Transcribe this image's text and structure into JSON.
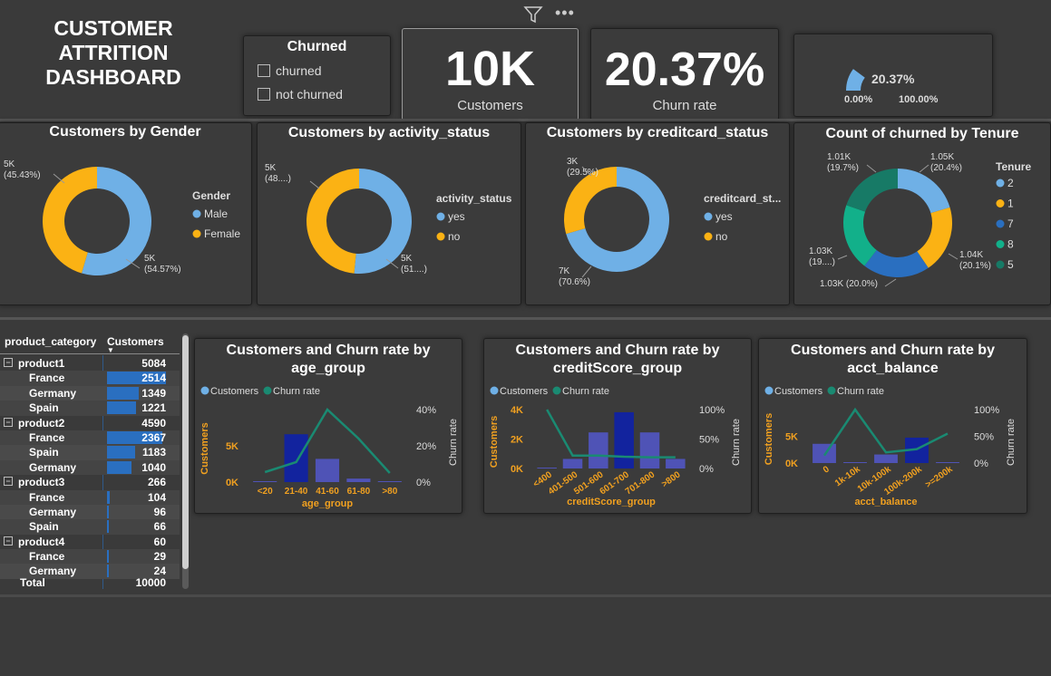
{
  "title": "CUSTOMER ATTRITION DASHBOARD",
  "title_lines": [
    "CUSTOMER",
    "ATTRITION",
    "DASHBOARD"
  ],
  "toolbar": {
    "filter_icon": "filter-icon",
    "more_icon": "more-options-icon"
  },
  "slicer": {
    "title": "Churned",
    "options": [
      "churned",
      "not churned"
    ]
  },
  "kpis": {
    "customers_value": "10K",
    "customers_label": "Customers",
    "churn_value": "20.37%",
    "churn_label": "Churn rate"
  },
  "gauge": {
    "value": 0.2037,
    "value_label": "20.37%",
    "min_label": "0.00%",
    "max_label": "100.00%"
  },
  "colors": {
    "blue": "#6fb0e6",
    "orange": "#fbb214",
    "navy": "#12239e",
    "purple": "#4f53b6",
    "teal": "#1a8a72",
    "green": "#12b08a",
    "darkblue": "#2a6fc0",
    "darkteal": "#177a66"
  },
  "donuts": [
    {
      "title": "Customers by Gender",
      "legend_title": "Gender",
      "legend": [
        "Male",
        "Female"
      ],
      "values": [
        54.57,
        45.43
      ],
      "labels": [
        [
          "5K",
          "(54.57%)"
        ],
        [
          "5K",
          "(45.43%)"
        ]
      ]
    },
    {
      "title": "Customers by activity_status",
      "legend_title": "activity_status",
      "legend": [
        "yes",
        "no"
      ],
      "values": [
        51.5,
        48.5
      ],
      "labels": [
        [
          "5K",
          "(51....)"
        ],
        [
          "5K",
          "(48....)"
        ]
      ]
    },
    {
      "title": "Customers by creditcard_status",
      "legend_title": "creditcard_st...",
      "legend": [
        "yes",
        "no"
      ],
      "values": [
        70.6,
        29.5
      ],
      "labels": [
        [
          "7K",
          "(70.6%)"
        ],
        [
          "3K",
          "(29.5%)"
        ]
      ]
    },
    {
      "title": "Count of churned by Tenure",
      "legend_title": "Tenure",
      "legend": [
        "2",
        "1",
        "7",
        "8",
        "5"
      ],
      "values": [
        20.4,
        20.1,
        20.0,
        19.8,
        19.7
      ],
      "labels": [
        [
          "1.05K",
          "(20.4%)"
        ],
        [
          "1.04K",
          "(20.1%)"
        ],
        [
          "1.03K (20.0%)",
          ""
        ],
        [
          "1.03K",
          "(19....)"
        ],
        [
          "1.01K",
          "(19.7%)"
        ]
      ]
    }
  ],
  "table": {
    "headers": [
      "product_category",
      "Customers"
    ],
    "rows": [
      {
        "label": "product1",
        "value": "5084",
        "level": 0,
        "frac": 0
      },
      {
        "label": "France",
        "value": "2514",
        "level": 1,
        "frac": 1.0
      },
      {
        "label": "Germany",
        "value": "1349",
        "level": 1,
        "frac": 0.537
      },
      {
        "label": "Spain",
        "value": "1221",
        "level": 1,
        "frac": 0.486
      },
      {
        "label": "product2",
        "value": "4590",
        "level": 0,
        "frac": 0
      },
      {
        "label": "France",
        "value": "2367",
        "level": 1,
        "frac": 0.942
      },
      {
        "label": "Spain",
        "value": "1183",
        "level": 1,
        "frac": 0.471
      },
      {
        "label": "Germany",
        "value": "1040",
        "level": 1,
        "frac": 0.414
      },
      {
        "label": "product3",
        "value": "266",
        "level": 0,
        "frac": 0
      },
      {
        "label": "France",
        "value": "104",
        "level": 1,
        "frac": 0.041
      },
      {
        "label": "Germany",
        "value": "96",
        "level": 1,
        "frac": 0.038
      },
      {
        "label": "Spain",
        "value": "66",
        "level": 1,
        "frac": 0.026
      },
      {
        "label": "product4",
        "value": "60",
        "level": 0,
        "frac": 0
      },
      {
        "label": "France",
        "value": "29",
        "level": 1,
        "frac": 0.012
      },
      {
        "label": "Germany",
        "value": "24",
        "level": 1,
        "frac": 0.01
      }
    ],
    "total_label": "Total",
    "total_value": "10000"
  },
  "chart_data": [
    {
      "type": "bar",
      "title": "Customers and Churn rate by age_group",
      "legend": [
        "Customers",
        "Churn rate"
      ],
      "categories": [
        "<20",
        "21-40",
        "41-60",
        "61-80",
        ">80"
      ],
      "series": [
        {
          "name": "Customers",
          "values": [
            90,
            6600,
            3200,
            480,
            80
          ]
        },
        {
          "name": "Churn rate",
          "values": [
            5.5,
            11,
            40,
            24,
            5
          ]
        }
      ],
      "xlabel": "age_group",
      "ylabel": "Customers",
      "y2label": "Churn rate",
      "ylim": [
        0,
        10000
      ],
      "y2lim": [
        0,
        40
      ],
      "yticks": [
        "0K",
        "5K"
      ],
      "y2ticks": [
        "0%",
        "20%",
        "40%"
      ]
    },
    {
      "type": "bar",
      "title": "Customers and Churn rate by creditScore_group",
      "legend": [
        "Customers",
        "Churn rate"
      ],
      "categories": [
        "<400",
        "401-500",
        "501-600",
        "601-700",
        "701-800",
        ">800"
      ],
      "series": [
        {
          "name": "Customers",
          "values": [
            20,
            650,
            2450,
            3820,
            2450,
            650
          ]
        },
        {
          "name": "Churn rate",
          "values": [
            100,
            22,
            22,
            20,
            19,
            19
          ]
        }
      ],
      "xlabel": "creditScore_group",
      "ylabel": "Customers",
      "y2label": "Churn rate",
      "ylim": [
        0,
        4000
      ],
      "y2lim": [
        0,
        100
      ],
      "yticks": [
        "0K",
        "2K",
        "4K"
      ],
      "y2ticks": [
        "0%",
        "50%",
        "100%"
      ]
    },
    {
      "type": "bar",
      "title": "Customers and Churn rate by acct_balance",
      "legend": [
        "Customers",
        "Churn rate"
      ],
      "categories": [
        "0",
        "1k-10k",
        "10k-100k",
        "100k-200k",
        ">=200k"
      ],
      "series": [
        {
          "name": "Customers",
          "values": [
            3600,
            50,
            1600,
            4750,
            50
          ]
        },
        {
          "name": "Churn rate",
          "values": [
            14,
            100,
            20,
            26,
            55
          ]
        }
      ],
      "xlabel": "acct_balance",
      "ylabel": "Customers",
      "y2label": "Churn rate",
      "ylim": [
        0,
        10000
      ],
      "y2lim": [
        0,
        100
      ],
      "yticks": [
        "0K",
        "5K"
      ],
      "y2ticks": [
        "0%",
        "50%",
        "100%"
      ]
    }
  ]
}
